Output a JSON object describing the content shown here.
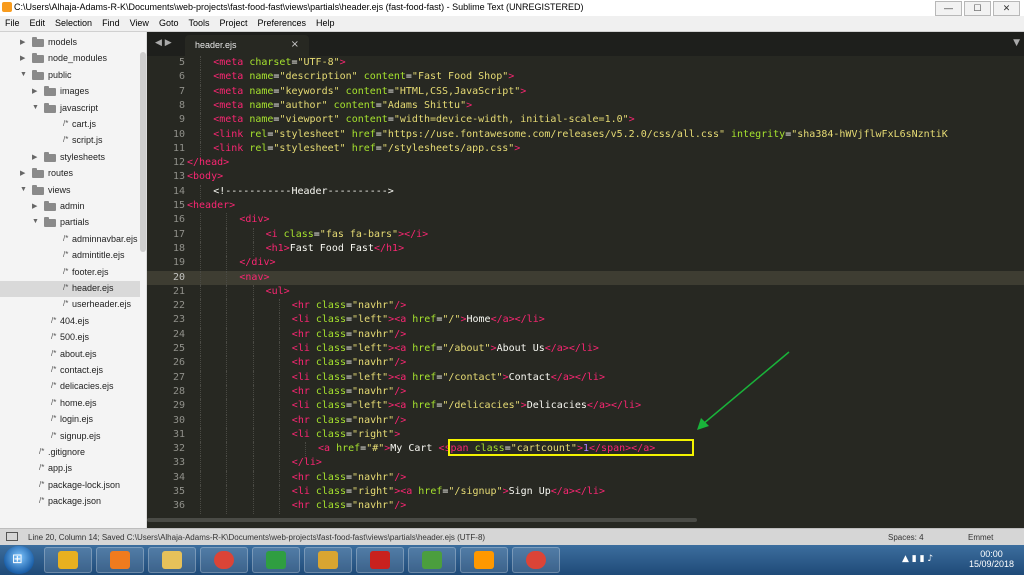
{
  "window": {
    "title": "C:\\Users\\Alhaja-Adams-R-K\\Documents\\web-projects\\fast-food-fast\\views\\partials\\header.ejs (fast-food-fast) - Sublime Text (UNREGISTERED)",
    "min": "—",
    "max": "☐",
    "close": "✕"
  },
  "menu": [
    "File",
    "Edit",
    "Selection",
    "Find",
    "View",
    "Goto",
    "Tools",
    "Project",
    "Preferences",
    "Help"
  ],
  "sidebar": {
    "items": [
      {
        "label": "models",
        "type": "folder",
        "depth": 1,
        "open": false
      },
      {
        "label": "node_modules",
        "type": "folder",
        "depth": 1,
        "open": false
      },
      {
        "label": "public",
        "type": "folder",
        "depth": 1,
        "open": true
      },
      {
        "label": "images",
        "type": "folder",
        "depth": 2,
        "open": false
      },
      {
        "label": "javascript",
        "type": "folder",
        "depth": 2,
        "open": true
      },
      {
        "label": "cart.js",
        "type": "file",
        "depth": 3
      },
      {
        "label": "script.js",
        "type": "file",
        "depth": 3
      },
      {
        "label": "stylesheets",
        "type": "folder",
        "depth": 2,
        "open": false
      },
      {
        "label": "routes",
        "type": "folder",
        "depth": 1,
        "open": false
      },
      {
        "label": "views",
        "type": "folder",
        "depth": 1,
        "open": true
      },
      {
        "label": "admin",
        "type": "folder",
        "depth": 2,
        "open": false
      },
      {
        "label": "partials",
        "type": "folder",
        "depth": 2,
        "open": true
      },
      {
        "label": "adminnavbar.ejs",
        "type": "file",
        "depth": 3
      },
      {
        "label": "admintitle.ejs",
        "type": "file",
        "depth": 3
      },
      {
        "label": "footer.ejs",
        "type": "file",
        "depth": 3
      },
      {
        "label": "header.ejs",
        "type": "file",
        "depth": 3,
        "selected": true
      },
      {
        "label": "userheader.ejs",
        "type": "file",
        "depth": 3
      },
      {
        "label": "404.ejs",
        "type": "file",
        "depth": 2
      },
      {
        "label": "500.ejs",
        "type": "file",
        "depth": 2
      },
      {
        "label": "about.ejs",
        "type": "file",
        "depth": 2
      },
      {
        "label": "contact.ejs",
        "type": "file",
        "depth": 2
      },
      {
        "label": "delicacies.ejs",
        "type": "file",
        "depth": 2
      },
      {
        "label": "home.ejs",
        "type": "file",
        "depth": 2
      },
      {
        "label": "login.ejs",
        "type": "file",
        "depth": 2
      },
      {
        "label": "signup.ejs",
        "type": "file",
        "depth": 2
      },
      {
        "label": ".gitignore",
        "type": "file",
        "depth": 1
      },
      {
        "label": "app.js",
        "type": "file",
        "depth": 1
      },
      {
        "label": "package-lock.json",
        "type": "file",
        "depth": 1
      },
      {
        "label": "package.json",
        "type": "file",
        "depth": 1
      }
    ]
  },
  "tabs": [
    {
      "label": "header.ejs",
      "close": "×"
    }
  ],
  "editor": {
    "current_line": 20,
    "lines": [
      {
        "n": 5,
        "indent": 2,
        "tokens": [
          [
            "t",
            "<meta "
          ],
          [
            "a",
            "charset"
          ],
          [
            "c",
            "="
          ],
          [
            "s",
            "\"UTF-8\""
          ],
          [
            "t",
            ">"
          ]
        ]
      },
      {
        "n": 6,
        "indent": 2,
        "tokens": [
          [
            "t",
            "<meta "
          ],
          [
            "a",
            "name"
          ],
          [
            "c",
            "="
          ],
          [
            "s",
            "\"description\" "
          ],
          [
            "a",
            "content"
          ],
          [
            "c",
            "="
          ],
          [
            "s",
            "\"Fast Food Shop\""
          ],
          [
            "t",
            ">"
          ]
        ]
      },
      {
        "n": 7,
        "indent": 2,
        "tokens": [
          [
            "t",
            "<meta "
          ],
          [
            "a",
            "name"
          ],
          [
            "c",
            "="
          ],
          [
            "s",
            "\"keywords\" "
          ],
          [
            "a",
            "content"
          ],
          [
            "c",
            "="
          ],
          [
            "s",
            "\"HTML,CSS,JavaScript\""
          ],
          [
            "t",
            ">"
          ]
        ]
      },
      {
        "n": 8,
        "indent": 2,
        "tokens": [
          [
            "t",
            "<meta "
          ],
          [
            "a",
            "name"
          ],
          [
            "c",
            "="
          ],
          [
            "s",
            "\"author\" "
          ],
          [
            "a",
            "content"
          ],
          [
            "c",
            "="
          ],
          [
            "s",
            "\"Adams Shittu\""
          ],
          [
            "t",
            ">"
          ]
        ]
      },
      {
        "n": 9,
        "indent": 2,
        "tokens": [
          [
            "t",
            "<meta "
          ],
          [
            "a",
            "name"
          ],
          [
            "c",
            "="
          ],
          [
            "s",
            "\"viewport\" "
          ],
          [
            "a",
            "content"
          ],
          [
            "c",
            "="
          ],
          [
            "s",
            "\"width=device-width, initial-scale=1.0\""
          ],
          [
            "t",
            ">"
          ]
        ]
      },
      {
        "n": 10,
        "indent": 2,
        "tokens": [
          [
            "t",
            "<link "
          ],
          [
            "a",
            "rel"
          ],
          [
            "c",
            "="
          ],
          [
            "s",
            "\"stylesheet\" "
          ],
          [
            "a",
            "href"
          ],
          [
            "c",
            "="
          ],
          [
            "s",
            "\"https://use.fontawesome.com/releases/v5.2.0/css/all.css\" "
          ],
          [
            "a",
            "integrity"
          ],
          [
            "c",
            "="
          ],
          [
            "s",
            "\"sha384-hWVjflwFxL6sNzntiK"
          ]
        ]
      },
      {
        "n": 11,
        "indent": 2,
        "tokens": [
          [
            "t",
            "<link "
          ],
          [
            "a",
            "rel"
          ],
          [
            "c",
            "="
          ],
          [
            "s",
            "\"stylesheet\" "
          ],
          [
            "a",
            "href"
          ],
          [
            "c",
            "="
          ],
          [
            "s",
            "\"/stylesheets/app.css\""
          ],
          [
            "t",
            ">"
          ]
        ]
      },
      {
        "n": 12,
        "indent": 0,
        "tokens": [
          [
            "t",
            "</head>"
          ]
        ]
      },
      {
        "n": 13,
        "indent": 0,
        "tokens": [
          [
            "t",
            "<body>"
          ]
        ]
      },
      {
        "n": 14,
        "indent": 2,
        "tokens": [
          [
            "c",
            "<!-----------Header---------->"
          ]
        ]
      },
      {
        "n": 15,
        "indent": 0,
        "tokens": [
          [
            "t",
            "<header>"
          ]
        ]
      },
      {
        "n": 16,
        "indent": 4,
        "tokens": [
          [
            "t",
            "<div>"
          ]
        ]
      },
      {
        "n": 17,
        "indent": 6,
        "tokens": [
          [
            "t",
            "<i "
          ],
          [
            "a",
            "class"
          ],
          [
            "c",
            "="
          ],
          [
            "s",
            "\"fas fa-bars\""
          ],
          [
            "t",
            "></i>"
          ]
        ]
      },
      {
        "n": 18,
        "indent": 6,
        "tokens": [
          [
            "t",
            "<h1>"
          ],
          [
            "c",
            "Fast Food Fast"
          ],
          [
            "t",
            "</h1>"
          ]
        ]
      },
      {
        "n": 19,
        "indent": 4,
        "tokens": [
          [
            "t",
            "</div>"
          ]
        ]
      },
      {
        "n": 20,
        "indent": 4,
        "tokens": [
          [
            "t",
            "<nav>"
          ]
        ]
      },
      {
        "n": 21,
        "indent": 6,
        "tokens": [
          [
            "t",
            "<ul>"
          ]
        ]
      },
      {
        "n": 22,
        "indent": 8,
        "tokens": [
          [
            "t",
            "<hr "
          ],
          [
            "a",
            "class"
          ],
          [
            "c",
            "="
          ],
          [
            "s",
            "\"navhr\""
          ],
          [
            "t",
            "/>"
          ]
        ]
      },
      {
        "n": 23,
        "indent": 8,
        "tokens": [
          [
            "t",
            "<li "
          ],
          [
            "a",
            "class"
          ],
          [
            "c",
            "="
          ],
          [
            "s",
            "\"left\""
          ],
          [
            "t",
            ">"
          ],
          [
            "t",
            "<a "
          ],
          [
            "a",
            "href"
          ],
          [
            "c",
            "="
          ],
          [
            "s",
            "\"/\""
          ],
          [
            "t",
            ">"
          ],
          [
            "c",
            "Home"
          ],
          [
            "t",
            "</a></li>"
          ]
        ]
      },
      {
        "n": 24,
        "indent": 8,
        "tokens": [
          [
            "t",
            "<hr "
          ],
          [
            "a",
            "class"
          ],
          [
            "c",
            "="
          ],
          [
            "s",
            "\"navhr\""
          ],
          [
            "t",
            "/>"
          ]
        ]
      },
      {
        "n": 25,
        "indent": 8,
        "tokens": [
          [
            "t",
            "<li "
          ],
          [
            "a",
            "class"
          ],
          [
            "c",
            "="
          ],
          [
            "s",
            "\"left\""
          ],
          [
            "t",
            ">"
          ],
          [
            "t",
            "<a "
          ],
          [
            "a",
            "href"
          ],
          [
            "c",
            "="
          ],
          [
            "s",
            "\"/about\""
          ],
          [
            "t",
            ">"
          ],
          [
            "c",
            "About Us"
          ],
          [
            "t",
            "</a></li>"
          ]
        ]
      },
      {
        "n": 26,
        "indent": 8,
        "tokens": [
          [
            "t",
            "<hr "
          ],
          [
            "a",
            "class"
          ],
          [
            "c",
            "="
          ],
          [
            "s",
            "\"navhr\""
          ],
          [
            "t",
            "/>"
          ]
        ]
      },
      {
        "n": 27,
        "indent": 8,
        "tokens": [
          [
            "t",
            "<li "
          ],
          [
            "a",
            "class"
          ],
          [
            "c",
            "="
          ],
          [
            "s",
            "\"left\""
          ],
          [
            "t",
            ">"
          ],
          [
            "t",
            "<a "
          ],
          [
            "a",
            "href"
          ],
          [
            "c",
            "="
          ],
          [
            "s",
            "\"/contact\""
          ],
          [
            "t",
            ">"
          ],
          [
            "c",
            "Contact"
          ],
          [
            "t",
            "</a></li>"
          ]
        ]
      },
      {
        "n": 28,
        "indent": 8,
        "tokens": [
          [
            "t",
            "<hr "
          ],
          [
            "a",
            "class"
          ],
          [
            "c",
            "="
          ],
          [
            "s",
            "\"navhr\""
          ],
          [
            "t",
            "/>"
          ]
        ]
      },
      {
        "n": 29,
        "indent": 8,
        "tokens": [
          [
            "t",
            "<li "
          ],
          [
            "a",
            "class"
          ],
          [
            "c",
            "="
          ],
          [
            "s",
            "\"left\""
          ],
          [
            "t",
            ">"
          ],
          [
            "t",
            "<a "
          ],
          [
            "a",
            "href"
          ],
          [
            "c",
            "="
          ],
          [
            "s",
            "\"/delicacies\""
          ],
          [
            "t",
            ">"
          ],
          [
            "c",
            "Delicacies"
          ],
          [
            "t",
            "</a></li>"
          ]
        ]
      },
      {
        "n": 30,
        "indent": 8,
        "tokens": [
          [
            "t",
            "<hr "
          ],
          [
            "a",
            "class"
          ],
          [
            "c",
            "="
          ],
          [
            "s",
            "\"navhr\""
          ],
          [
            "t",
            "/>"
          ]
        ]
      },
      {
        "n": 31,
        "indent": 8,
        "tokens": [
          [
            "t",
            "<li "
          ],
          [
            "a",
            "class"
          ],
          [
            "c",
            "="
          ],
          [
            "s",
            "\"right\""
          ],
          [
            "t",
            ">"
          ]
        ]
      },
      {
        "n": 32,
        "indent": 10,
        "tokens": [
          [
            "t",
            "<a "
          ],
          [
            "a",
            "href"
          ],
          [
            "c",
            "="
          ],
          [
            "s",
            "\"#\""
          ],
          [
            "t",
            ">"
          ],
          [
            "c",
            "My Cart "
          ],
          [
            "t",
            "<span "
          ],
          [
            "a",
            "class"
          ],
          [
            "c",
            "="
          ],
          [
            "s",
            "\"cartcount\""
          ],
          [
            "t",
            ">"
          ],
          [
            "n",
            "1"
          ],
          [
            "t",
            "</span></a>"
          ]
        ]
      },
      {
        "n": 33,
        "indent": 8,
        "tokens": [
          [
            "t",
            "</li>"
          ]
        ]
      },
      {
        "n": 34,
        "indent": 8,
        "tokens": [
          [
            "t",
            "<hr "
          ],
          [
            "a",
            "class"
          ],
          [
            "c",
            "="
          ],
          [
            "s",
            "\"navhr\""
          ],
          [
            "t",
            "/>"
          ]
        ]
      },
      {
        "n": 35,
        "indent": 8,
        "tokens": [
          [
            "t",
            "<li "
          ],
          [
            "a",
            "class"
          ],
          [
            "c",
            "="
          ],
          [
            "s",
            "\"right\""
          ],
          [
            "t",
            ">"
          ],
          [
            "t",
            "<a "
          ],
          [
            "a",
            "href"
          ],
          [
            "c",
            "="
          ],
          [
            "s",
            "\"/signup\""
          ],
          [
            "t",
            ">"
          ],
          [
            "c",
            "Sign Up"
          ],
          [
            "t",
            "</a></li>"
          ]
        ]
      },
      {
        "n": 36,
        "indent": 8,
        "tokens": [
          [
            "t",
            "<hr "
          ],
          [
            "a",
            "class"
          ],
          [
            "c",
            "="
          ],
          [
            "s",
            "\"navhr\""
          ],
          [
            "t",
            "/>"
          ]
        ]
      }
    ],
    "highlight_color": "#f3f300",
    "arrow_color": "#19b33a"
  },
  "status": {
    "text": "Line 20, Column 14; Saved C:\\Users\\Alhaja-Adams-R-K\\Documents\\web-projects\\fast-food-fast\\views\\partials\\header.ejs (UTF-8)",
    "spaces": "Spaces: 4",
    "syntax": "Emmet"
  },
  "taskbar": {
    "apps": [
      {
        "name": "start",
        "color": "#1b5fa8"
      },
      {
        "name": "app-icon-1",
        "color": "#e8b020"
      },
      {
        "name": "media-player-icon",
        "color": "#f07b1e"
      },
      {
        "name": "folder-icon",
        "color": "#e6c15a"
      },
      {
        "name": "chrome-icon",
        "color": "#db4437"
      },
      {
        "name": "etisalat-icon",
        "color": "#2f9e41"
      },
      {
        "name": "sheets-icon",
        "color": "#d9a531"
      },
      {
        "name": "pdf-icon",
        "color": "#c9211e"
      },
      {
        "name": "game-icon",
        "color": "#4b9e3e"
      },
      {
        "name": "sublime-icon",
        "color": "#ff9800"
      },
      {
        "name": "chrome-icon-2",
        "color": "#db4437"
      }
    ],
    "time": "00:00",
    "date": "15/09/2018"
  }
}
